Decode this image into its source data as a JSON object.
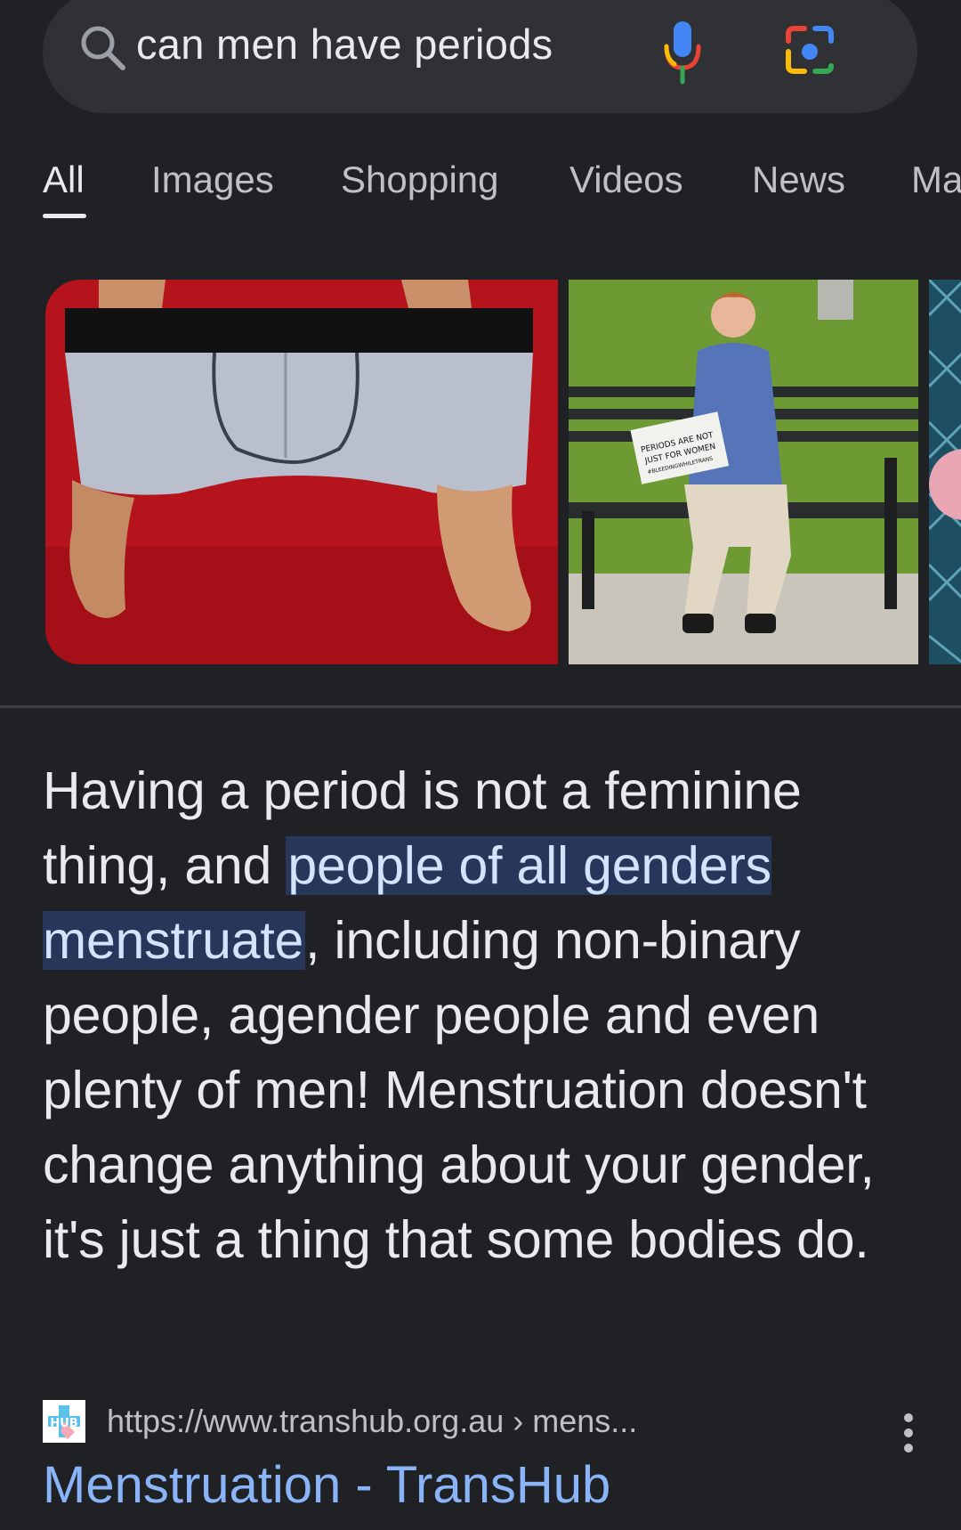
{
  "search": {
    "query": "can men have periods"
  },
  "tabs": [
    {
      "label": "All",
      "active": true
    },
    {
      "label": "Images"
    },
    {
      "label": "Shopping"
    },
    {
      "label": "Videos"
    },
    {
      "label": "News"
    },
    {
      "label": "Ma"
    }
  ],
  "images": {
    "second_image_sign": [
      "PERIODS ARE NOT",
      "JUST FOR WOMEN",
      "#BLEEDINGWHILETRANS"
    ]
  },
  "snippet": {
    "before_highlight": "Having a period is not a feminine thing, and ",
    "highlight": "people of all genders menstruate",
    "after_highlight": ", including non-binary people, agender people and even plenty of men! Menstruation doesn't change anything about your gender, it's just a thing that some bodies do."
  },
  "source": {
    "favicon_text": "HUB",
    "url": "https://www.transhub.org.au › mens...",
    "title": "Menstruation - TransHub"
  },
  "colors": {
    "background": "#1f2125",
    "search_bar": "#303134",
    "link": "#8ab4f8",
    "highlight": "#28365a"
  }
}
